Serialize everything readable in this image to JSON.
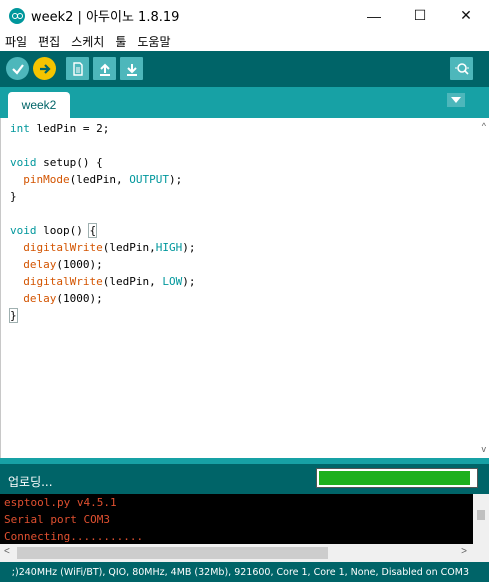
{
  "window": {
    "title": "week2 | 아두이노 1.8.19",
    "controls": [
      "—",
      "☐",
      "✕"
    ]
  },
  "menu": [
    "파일",
    "편집",
    "스케치",
    "툴",
    "도움말"
  ],
  "toolbar": {
    "buttons": [
      {
        "name": "verify",
        "icon": "check-icon"
      },
      {
        "name": "upload",
        "icon": "arrow-right-icon"
      },
      {
        "name": "new",
        "icon": "file-icon"
      },
      {
        "name": "open",
        "icon": "arrow-up-icon"
      },
      {
        "name": "save",
        "icon": "arrow-down-icon"
      }
    ],
    "serial_monitor_icon": "magnifier-icon"
  },
  "tabs": [
    {
      "label": "week2"
    }
  ],
  "editor": {
    "lines": [
      "int ledPin = 2;",
      "",
      "void setup() {",
      "  pinMode(ledPin, OUTPUT);",
      "}",
      "",
      "void loop() {",
      "  digitalWrite(ledPin,HIGH);",
      "  delay(1000);",
      "  digitalWrite(ledPin, LOW);",
      "  delay(1000);",
      "}"
    ]
  },
  "status": {
    "text": "업로딩...",
    "progress": 0.97
  },
  "console": {
    "lines": [
      "esptool.py v4.5.1",
      "Serial port COM3",
      "Connecting..........."
    ]
  },
  "boardbar": {
    "text": ";)240MHz (WiFi/BT), QIO, 80MHz, 4MB (32Mb), 921600, Core 1, Core 1, None, Disabled on COM3"
  },
  "colors": {
    "teal_dark": "#006468",
    "teal": "#17a1a5",
    "keyword": "#00979c",
    "function": "#d35400",
    "console_text": "#e05030",
    "progress_fill": "#1eb01e"
  }
}
